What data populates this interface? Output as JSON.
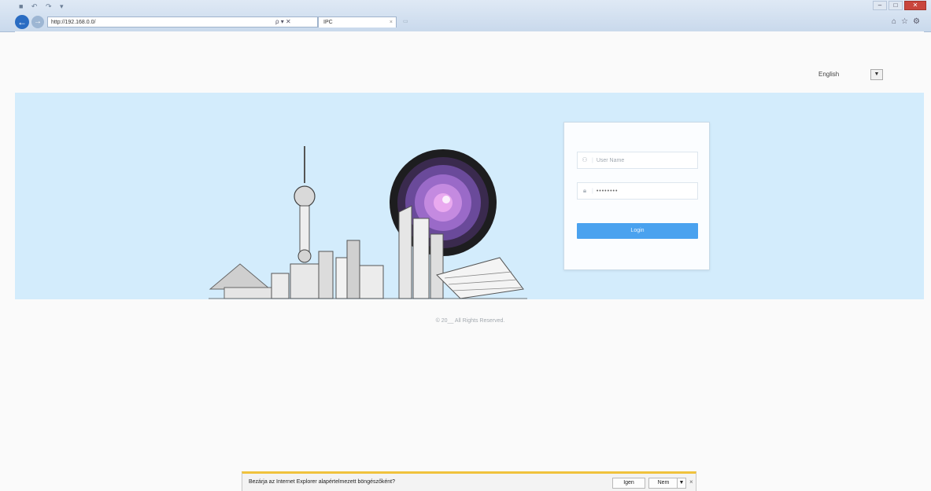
{
  "browser": {
    "address": "http://192.168.0.0/",
    "tab_title": "IPC",
    "tab_close": "×",
    "back_glyph": "←",
    "forward_glyph": "→",
    "addr_icons": "ρ ▾ ✕",
    "win_controls": [
      "–",
      "□",
      "✕"
    ],
    "tools_glyphs": "⌂☆⚙"
  },
  "header": {
    "language": "English",
    "language_arrow": "▼"
  },
  "login": {
    "username_placeholder": "User Name",
    "password_value": "••••••••",
    "login_button": "Login",
    "user_icon": "user-icon",
    "lock_icon": "lock-icon"
  },
  "footer": {
    "copyright": "© 20__ All Rights Reserved."
  },
  "download_bar": {
    "question": "Bezárja az Internet Explorer alapértelmezett böngészőként?",
    "save_label": "Igen",
    "open_label": "Nem",
    "dropdown_glyph": "▼",
    "close_glyph": "×"
  },
  "colors": {
    "banner": "#d3ecfc",
    "login_button": "#4aa2ef",
    "notification_accent": "#f0c23c"
  }
}
